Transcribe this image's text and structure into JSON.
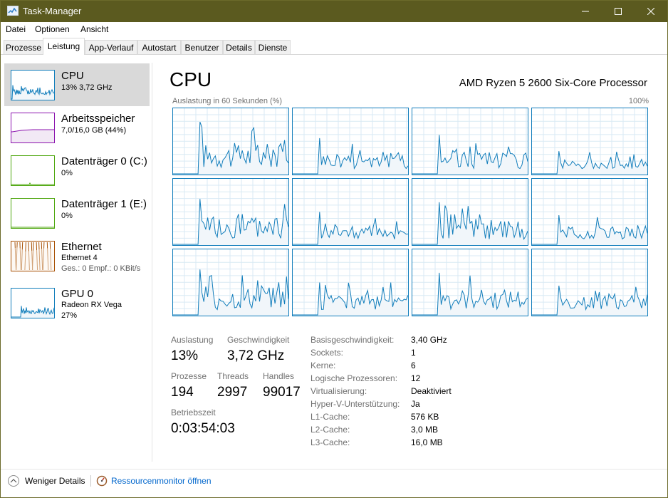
{
  "window": {
    "title": "Task-Manager"
  },
  "menu": {
    "file": "Datei",
    "options": "Optionen",
    "view": "Ansicht"
  },
  "tabs": [
    "Prozesse",
    "Leistung",
    "App-Verlauf",
    "Autostart",
    "Benutzer",
    "Details",
    "Dienste"
  ],
  "sidebar": {
    "cpu": {
      "title": "CPU",
      "sub": "13% 3,72 GHz"
    },
    "memory": {
      "title": "Arbeitsspeicher",
      "sub": "7,0/16,0 GB (44%)"
    },
    "disk0": {
      "title": "Datenträger 0 (C:)",
      "sub": "0%"
    },
    "disk1": {
      "title": "Datenträger 1 (E:)",
      "sub": "0%"
    },
    "ethernet": {
      "title": "Ethernet",
      "sub1": "Ethernet 4",
      "sub2": "Ges.: 0 Empf.: 0 KBit/s"
    },
    "gpu": {
      "title": "GPU 0",
      "sub1": "Radeon RX Vega",
      "sub2": "27%"
    }
  },
  "main": {
    "title": "CPU",
    "processor": "AMD Ryzen 5 2600 Six-Core Processor",
    "graph_label": "Auslastung in 60 Sekunden (%)",
    "graph_max": "100%",
    "stats": {
      "utilization_label": "Auslastung",
      "utilization": "13%",
      "speed_label": "Geschwindigkeit",
      "speed": "3,72 GHz",
      "processes_label": "Prozesse",
      "processes": "194",
      "threads_label": "Threads",
      "threads": "2997",
      "handles_label": "Handles",
      "handles": "99017",
      "uptime_label": "Betriebszeit",
      "uptime": "0:03:54:03"
    },
    "specs": [
      {
        "label": "Basisgeschwindigkeit:",
        "value": "3,40 GHz"
      },
      {
        "label": "Sockets:",
        "value": "1"
      },
      {
        "label": "Kerne:",
        "value": "6"
      },
      {
        "label": "Logische Prozessoren:",
        "value": "12"
      },
      {
        "label": "Virtualisierung:",
        "value": "Deaktiviert"
      },
      {
        "label": "Hyper-V-Unterstützung:",
        "value": "Ja"
      },
      {
        "label": "L1-Cache:",
        "value": "576 KB"
      },
      {
        "label": "L2-Cache:",
        "value": "3,0 MB"
      },
      {
        "label": "L3-Cache:",
        "value": "16,0 MB"
      }
    ]
  },
  "footer": {
    "fewer_details": "Weniger Details",
    "resource_monitor": "Ressourcenmonitor öffnen"
  },
  "colors": {
    "cpu": "#117dbb",
    "memory": "#8b12ae",
    "disk": "#4da60c",
    "ethernet": "#a74f01",
    "titlebar": "#5b5a1f",
    "selected": "#d9d9d9",
    "link": "#0066cc"
  },
  "core_series": [
    [
      0,
      0,
      0,
      0,
      0,
      0,
      0,
      0,
      0,
      0,
      0,
      0,
      0,
      0,
      0,
      0,
      0,
      0,
      0,
      0,
      0,
      0,
      0,
      0,
      0,
      0,
      0,
      0,
      0,
      0,
      0,
      0,
      0,
      0,
      0,
      0,
      0,
      0,
      0,
      0,
      0,
      0,
      0,
      0,
      0,
      0,
      0,
      0,
      0,
      0,
      0,
      0,
      0,
      0,
      0,
      0,
      0,
      0,
      0,
      0,
      0,
      0,
      0,
      0,
      0,
      0,
      0,
      0,
      0,
      0,
      0,
      0,
      0,
      0,
      0,
      0,
      0,
      0,
      0,
      0,
      0,
      0,
      0,
      0,
      0,
      0,
      0,
      0,
      0,
      0,
      0,
      0,
      0,
      0,
      0,
      0,
      0,
      0,
      0,
      0,
      0,
      0,
      0,
      0,
      0,
      0,
      0,
      0,
      0,
      0,
      0,
      0,
      0,
      0,
      0,
      0,
      0,
      0,
      0,
      0,
      0,
      0,
      0,
      0,
      0,
      0,
      0,
      0,
      0,
      0,
      0,
      0,
      0,
      0,
      0,
      0,
      0,
      0,
      0,
      0,
      0,
      0,
      0,
      0,
      0,
      0,
      0,
      0,
      0,
      0,
      0,
      0,
      0,
      0,
      0,
      0,
      0,
      0,
      0,
      0,
      0,
      0
    ]
  ],
  "core_levels": [
    [
      0,
      0,
      0,
      0,
      0,
      0,
      0,
      0,
      0,
      0,
      0,
      0,
      0,
      0,
      0,
      0,
      0,
      0,
      0,
      0,
      0,
      0,
      0,
      0,
      0,
      0,
      0,
      0,
      0,
      0,
      0,
      0,
      0,
      0,
      0,
      0,
      0,
      0,
      0,
      0,
      0,
      0,
      0,
      0,
      0,
      0,
      0,
      0,
      0,
      0,
      0,
      0,
      0,
      0,
      0,
      0,
      0,
      0,
      0,
      0
    ],
    [
      0,
      0,
      0,
      0,
      0,
      0,
      0,
      0,
      0,
      0,
      0,
      0,
      0,
      0,
      0,
      0,
      0,
      0,
      0,
      0,
      0,
      0,
      0,
      0,
      0,
      0,
      0,
      0,
      0,
      0,
      0,
      0,
      0,
      0,
      0,
      0,
      0,
      0,
      0,
      0,
      0,
      0,
      0,
      0,
      0,
      0,
      0,
      0,
      0,
      0,
      0,
      0,
      0,
      0,
      0,
      0,
      0,
      0,
      0,
      0
    ]
  ],
  "cores": [
    [
      0,
      0,
      0,
      0,
      0,
      0,
      0,
      0,
      0,
      0,
      0,
      0,
      0,
      0,
      0,
      0,
      0,
      0,
      0,
      0,
      0,
      0,
      0,
      0,
      0,
      0,
      0,
      0,
      0,
      0,
      0,
      0,
      0,
      0,
      0,
      0,
      0,
      0,
      0,
      0,
      0,
      0,
      0,
      0,
      0,
      0,
      0,
      0,
      0,
      0,
      0,
      0,
      0,
      0,
      0,
      0,
      0,
      0,
      0,
      0,
      0,
      0,
      0,
      0,
      0,
      0,
      0,
      0,
      0,
      0,
      0,
      0,
      0,
      0,
      0,
      0,
      0,
      0,
      0,
      0,
      0,
      0,
      0,
      0,
      0,
      0,
      0,
      0,
      0,
      0,
      0,
      0,
      0,
      0,
      0,
      0,
      0,
      0,
      0,
      0,
      0,
      0,
      0,
      0,
      0,
      0,
      0,
      0,
      0,
      0,
      0,
      0,
      0,
      0,
      0,
      0,
      0,
      0,
      0,
      0,
      0,
      0,
      0,
      0,
      0,
      0,
      0,
      0,
      0,
      0,
      0,
      0,
      0,
      0,
      0,
      0,
      0,
      0,
      0,
      0,
      0,
      0,
      0,
      0,
      0,
      0,
      0,
      0,
      0,
      0,
      0,
      0,
      0,
      0,
      0,
      0,
      0,
      0,
      0,
      0,
      0,
      0,
      0
    ]
  ]
}
